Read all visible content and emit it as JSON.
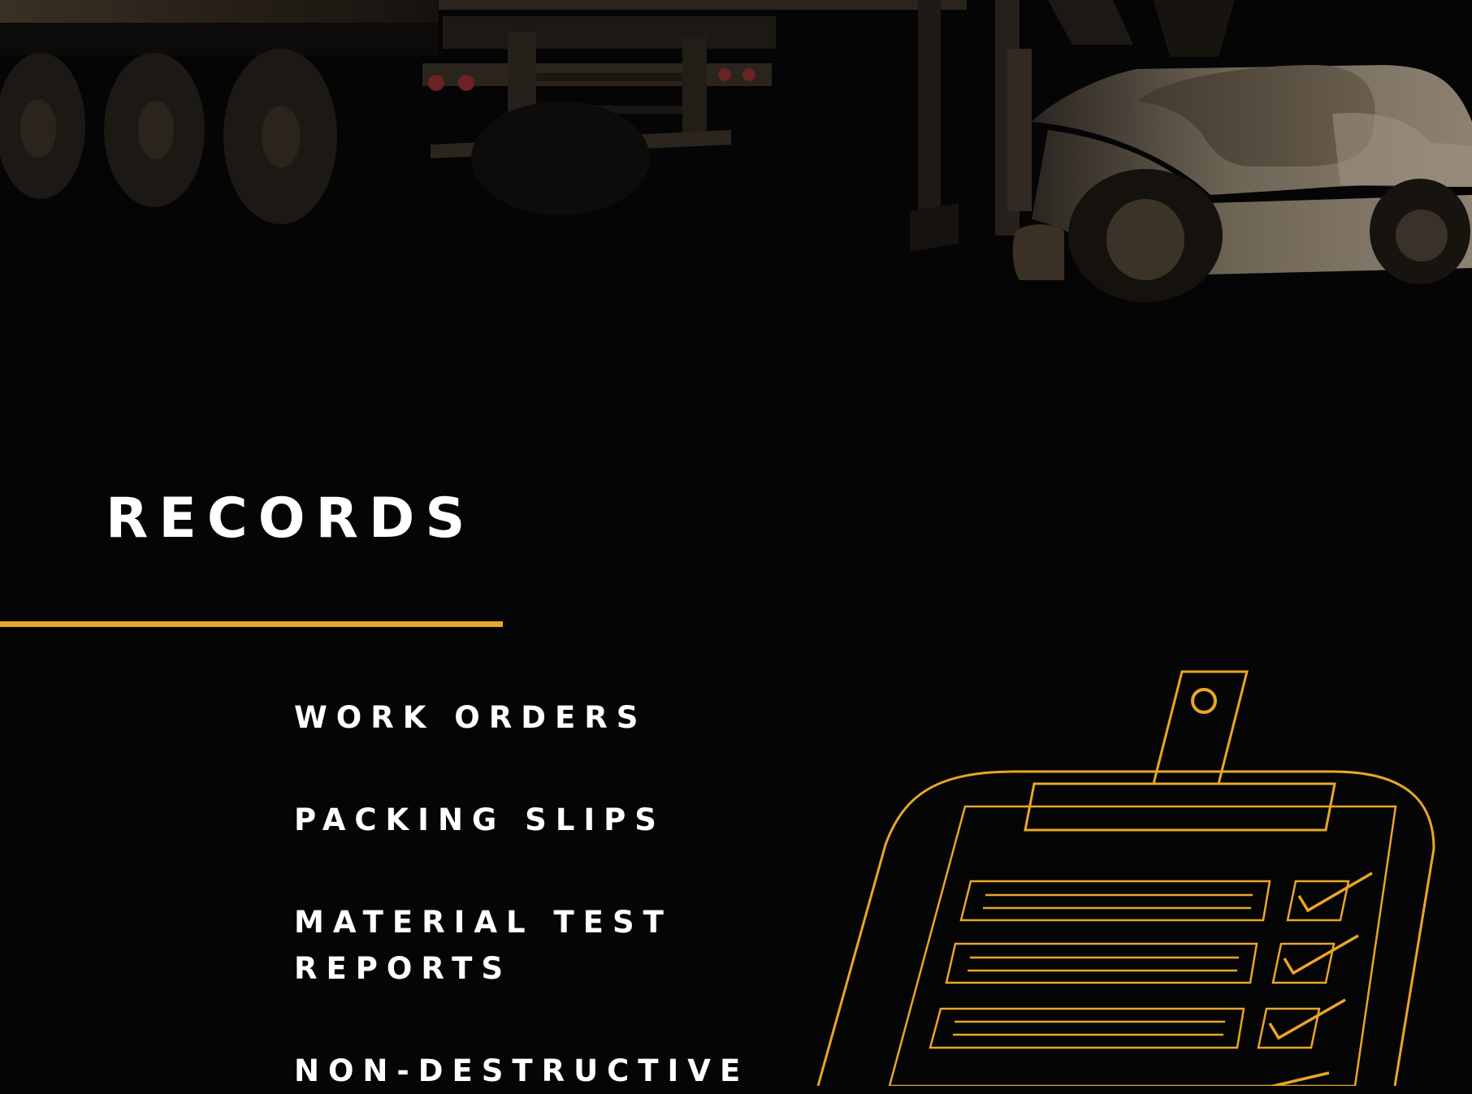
{
  "colors": {
    "background": "#050505",
    "accent": "#e9a627",
    "text": "#ffffff"
  },
  "hero": {
    "illustration": "truck-and-forklift-illustration"
  },
  "section": {
    "heading": "RECORDS",
    "items": [
      "WORK ORDERS",
      "PACKING SLIPS",
      "MATERIAL TEST REPORTS",
      "NON-DESTRUCTIVE"
    ]
  },
  "icons": {
    "clipboard": "clipboard-checklist-icon"
  }
}
